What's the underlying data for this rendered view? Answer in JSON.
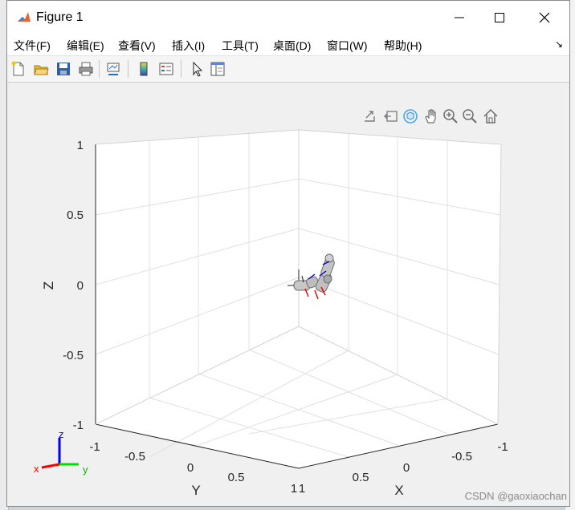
{
  "window": {
    "title": "Figure 1"
  },
  "menu": [
    "文件(F)",
    "编辑(E)",
    "查看(V)",
    "插入(I)",
    "工具(T)",
    "桌面(D)",
    "窗口(W)",
    "帮助(H)"
  ],
  "menu_overflow": "↘",
  "toolbar_icons": [
    "new-figure-icon",
    "open-file-icon",
    "save-icon",
    "print-icon",
    "link-plot-icon",
    "colorbar-icon",
    "legend-icon",
    "edit-plot-arrow-icon",
    "property-inspector-icon"
  ],
  "axes_toolbar_icons": [
    "export-icon",
    "brush-icon",
    "rotate-3d-icon",
    "pan-icon",
    "zoom-in-icon",
    "zoom-out-icon",
    "restore-view-icon"
  ],
  "axes": {
    "z_label": "Z",
    "x_label": "X",
    "y_label": "Y",
    "z_ticks": [
      "1",
      "0.5",
      "0",
      "-0.5",
      "-1"
    ],
    "y_ticks": [
      "-1",
      "-0.5",
      "0",
      "0.5",
      "1"
    ],
    "x_ticks": [
      "1",
      "0.5",
      "0",
      "-0.5",
      "-1"
    ],
    "grid": true,
    "box": "3d"
  },
  "triad": {
    "x": "x",
    "y": "y",
    "z": "z",
    "x_color": "#ff0000",
    "y_color": "#00dd00",
    "z_color": "#0000ff"
  },
  "watermark": "CSDN @gaoxiaochan"
}
